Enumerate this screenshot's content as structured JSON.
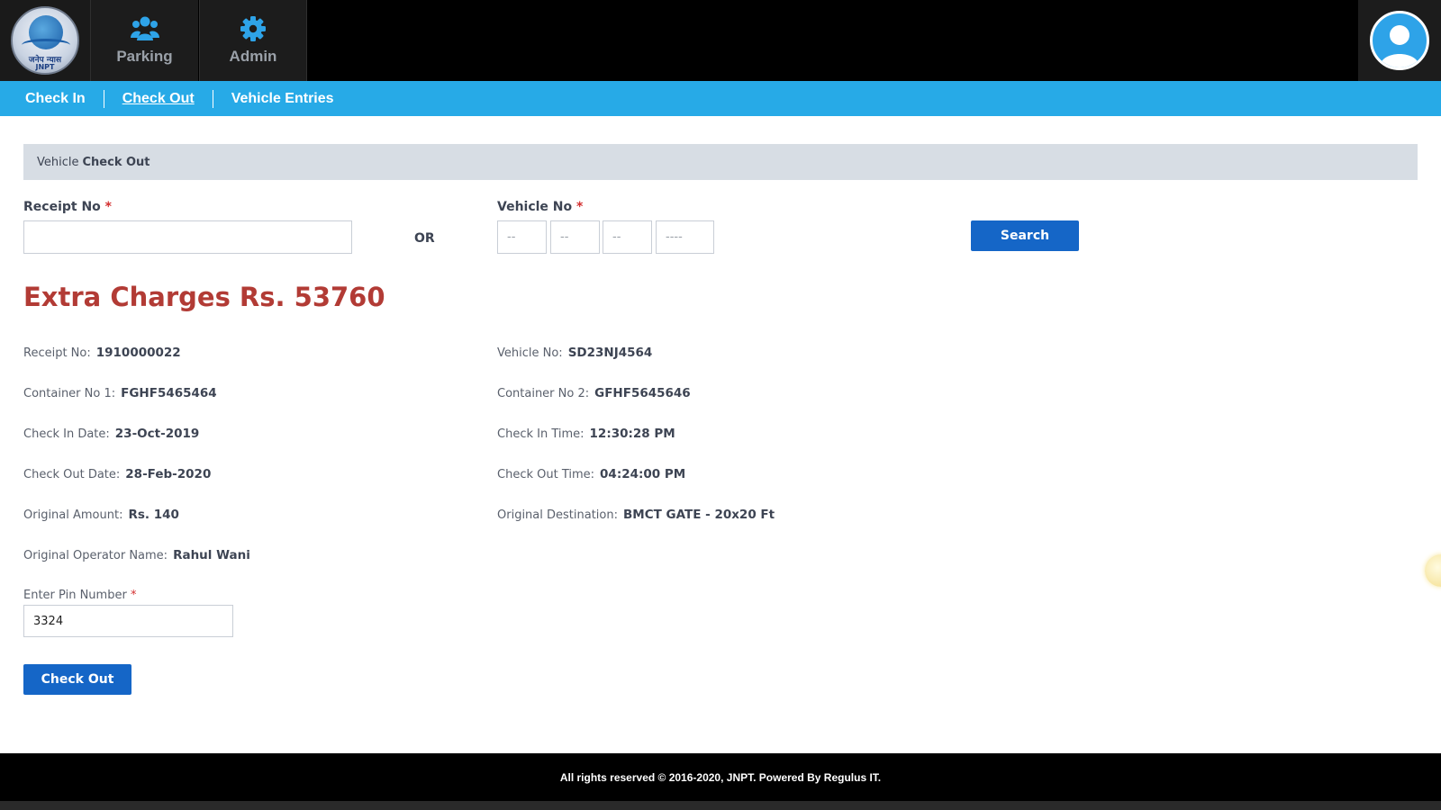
{
  "header": {
    "logo": {
      "text_line1": "जनेप न्यास",
      "text_line2": "JNPT"
    },
    "nav": [
      {
        "label": "Parking",
        "icon": "users-icon"
      },
      {
        "label": "Admin",
        "icon": "gear-icon"
      }
    ],
    "user_icon": "user-avatar-icon",
    "colors": {
      "bar": "#000000",
      "accent": "#2ea3e8"
    }
  },
  "subnav": {
    "items": [
      {
        "label": "Check In"
      },
      {
        "label": "Check Out"
      },
      {
        "label": "Vehicle Entries"
      }
    ],
    "active": "Check Out",
    "color": "#27aae7"
  },
  "panel": {
    "title_prefix": "Vehicle",
    "title_bold": "Check Out"
  },
  "search_form": {
    "receipt_label": "Receipt No",
    "receipt_value": "",
    "or_text": "OR",
    "vehicle_label": "Vehicle No",
    "vehicle_placeholders": [
      "--",
      "--",
      "--",
      "----"
    ],
    "required_mark": "*",
    "search_label": "Search"
  },
  "extra_charges": "Extra Charges Rs. 53760",
  "details": {
    "receipt_no": {
      "label": "Receipt No:",
      "value": "1910000022"
    },
    "vehicle_no": {
      "label": "Vehicle No:",
      "value": "SD23NJ4564"
    },
    "container_no_1": {
      "label": "Container No 1:",
      "value": "FGHF5465464"
    },
    "container_no_2": {
      "label": "Container No 2:",
      "value": "GFHF5645646"
    },
    "check_in_date": {
      "label": "Check In Date:",
      "value": "23-Oct-2019"
    },
    "check_in_time": {
      "label": "Check In Time:",
      "value": "12:30:28 PM"
    },
    "check_out_date": {
      "label": "Check Out Date:",
      "value": "28-Feb-2020"
    },
    "check_out_time": {
      "label": "Check Out Time:",
      "value": "04:24:00 PM"
    },
    "original_amount": {
      "label": "Original Amount:",
      "value": "Rs. 140"
    },
    "original_destination": {
      "label": "Original Destination:",
      "value": "BMCT GATE - 20x20 Ft"
    },
    "original_operator": {
      "label": "Original Operator Name:",
      "value": "Rahul Wani"
    }
  },
  "pin": {
    "label": "Enter Pin Number",
    "value": "3324"
  },
  "checkout_button": "Check Out",
  "footer": {
    "text": "All rights reserved © 2016-2020, JNPT. Powered By Regulus IT."
  }
}
